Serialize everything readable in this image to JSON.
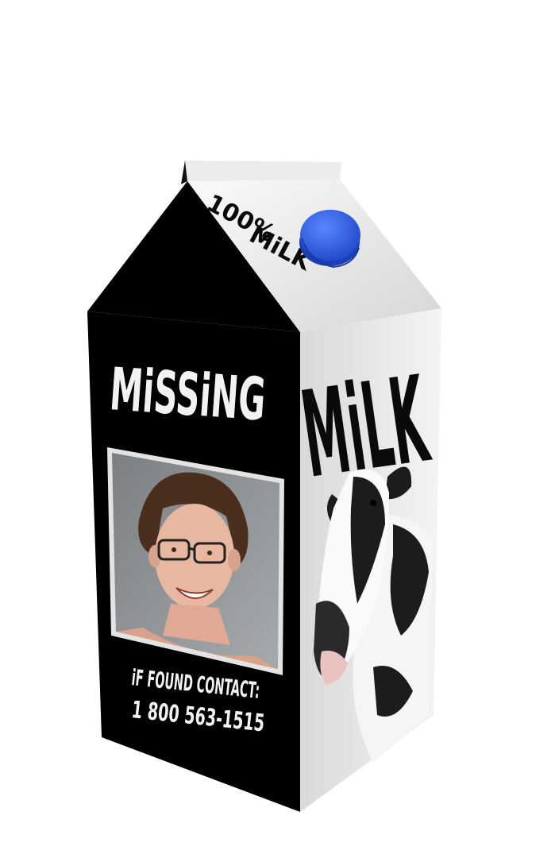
{
  "carton": {
    "front_title": "MiSSiNG",
    "found_line": "iF FOUND CONTACT:",
    "phone": "1 800 563-1515",
    "side_title": "MiLK",
    "top_line1": "100%",
    "top_line2": "MiLK"
  },
  "colors": {
    "front_panel": "#000000",
    "side_panel": "#e6e6e6",
    "roof_light": "#f0f0f0",
    "cap": "#2f63e8",
    "text_light": "#f2f2f2",
    "text_dark": "#0a0a0a"
  }
}
